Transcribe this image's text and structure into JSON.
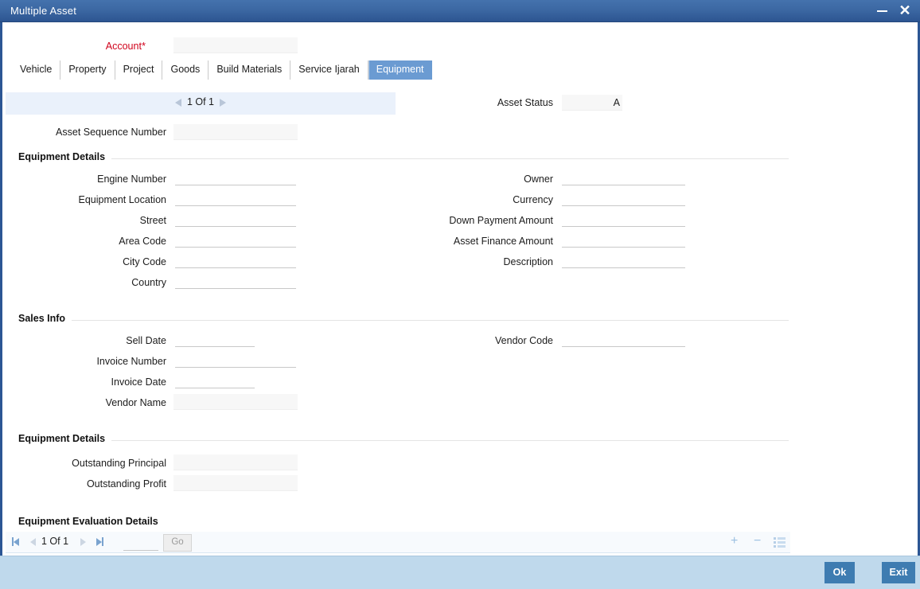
{
  "window": {
    "title": "Multiple Asset",
    "minimize_icon": "minimize-icon",
    "close_icon": "close-icon"
  },
  "account": {
    "label": "Account",
    "required_mark": "*",
    "value": "",
    "placeholder": ""
  },
  "tabs": [
    {
      "label": "Vehicle",
      "selected": false
    },
    {
      "label": "Property",
      "selected": false
    },
    {
      "label": "Project",
      "selected": false
    },
    {
      "label": "Goods",
      "selected": false
    },
    {
      "label": "Build Materials",
      "selected": false
    },
    {
      "label": "Service Ijarah",
      "selected": false
    },
    {
      "label": "Equipment",
      "selected": true
    }
  ],
  "record_pager": {
    "text": "1 Of 1",
    "prev_icon": "triangle-left-icon",
    "next_icon": "triangle-right-icon"
  },
  "asset_status": {
    "label": "Asset Status",
    "value": "A"
  },
  "asset_sequence_number": {
    "label": "Asset Sequence Number",
    "value": ""
  },
  "sections": {
    "equipment_details_1": "Equipment Details",
    "sales_info": "Sales Info",
    "equipment_details_2": "Equipment Details",
    "equipment_evaluation_details": "Equipment Evaluation Details"
  },
  "equipment_details": {
    "left": [
      {
        "label": "Engine Number",
        "value": ""
      },
      {
        "label": "Equipment Location",
        "value": ""
      },
      {
        "label": "Street",
        "value": ""
      },
      {
        "label": "Area Code",
        "value": ""
      },
      {
        "label": "City Code",
        "value": ""
      },
      {
        "label": "Country",
        "value": ""
      }
    ],
    "right": [
      {
        "label": "Owner",
        "value": ""
      },
      {
        "label": "Currency",
        "value": ""
      },
      {
        "label": "Down Payment Amount",
        "value": ""
      },
      {
        "label": "Asset Finance Amount",
        "value": ""
      },
      {
        "label": "Description",
        "value": ""
      }
    ]
  },
  "sales_info": {
    "left": [
      {
        "label": "Sell Date",
        "value": ""
      },
      {
        "label": "Invoice Number",
        "value": ""
      },
      {
        "label": "Invoice Date",
        "value": ""
      },
      {
        "label": "Vendor Name",
        "value": ""
      }
    ],
    "right": [
      {
        "label": "Vendor Code",
        "value": ""
      }
    ]
  },
  "outstanding": [
    {
      "label": "Outstanding Principal",
      "value": ""
    },
    {
      "label": "Outstanding Profit",
      "value": ""
    }
  ],
  "grid_toolbar": {
    "first_icon": "first-page-icon",
    "prev_icon": "previous-page-icon",
    "page_text": "1 Of 1",
    "next_icon": "next-page-icon",
    "last_icon": "last-page-icon",
    "page_input_value": "",
    "go_label": "Go",
    "add_label": "+",
    "remove_label": "−",
    "details_icon": "list-details-icon"
  },
  "footer": {
    "ok_label": "Ok",
    "exit_label": "Exit"
  },
  "colors": {
    "titlebar": "#3c68a3",
    "tab_selected": "#6b9bd2",
    "footer": "#bfd9ec",
    "button": "#3e7cb1",
    "required": "#d0021b",
    "pager_bg": "#eaf1fb"
  }
}
